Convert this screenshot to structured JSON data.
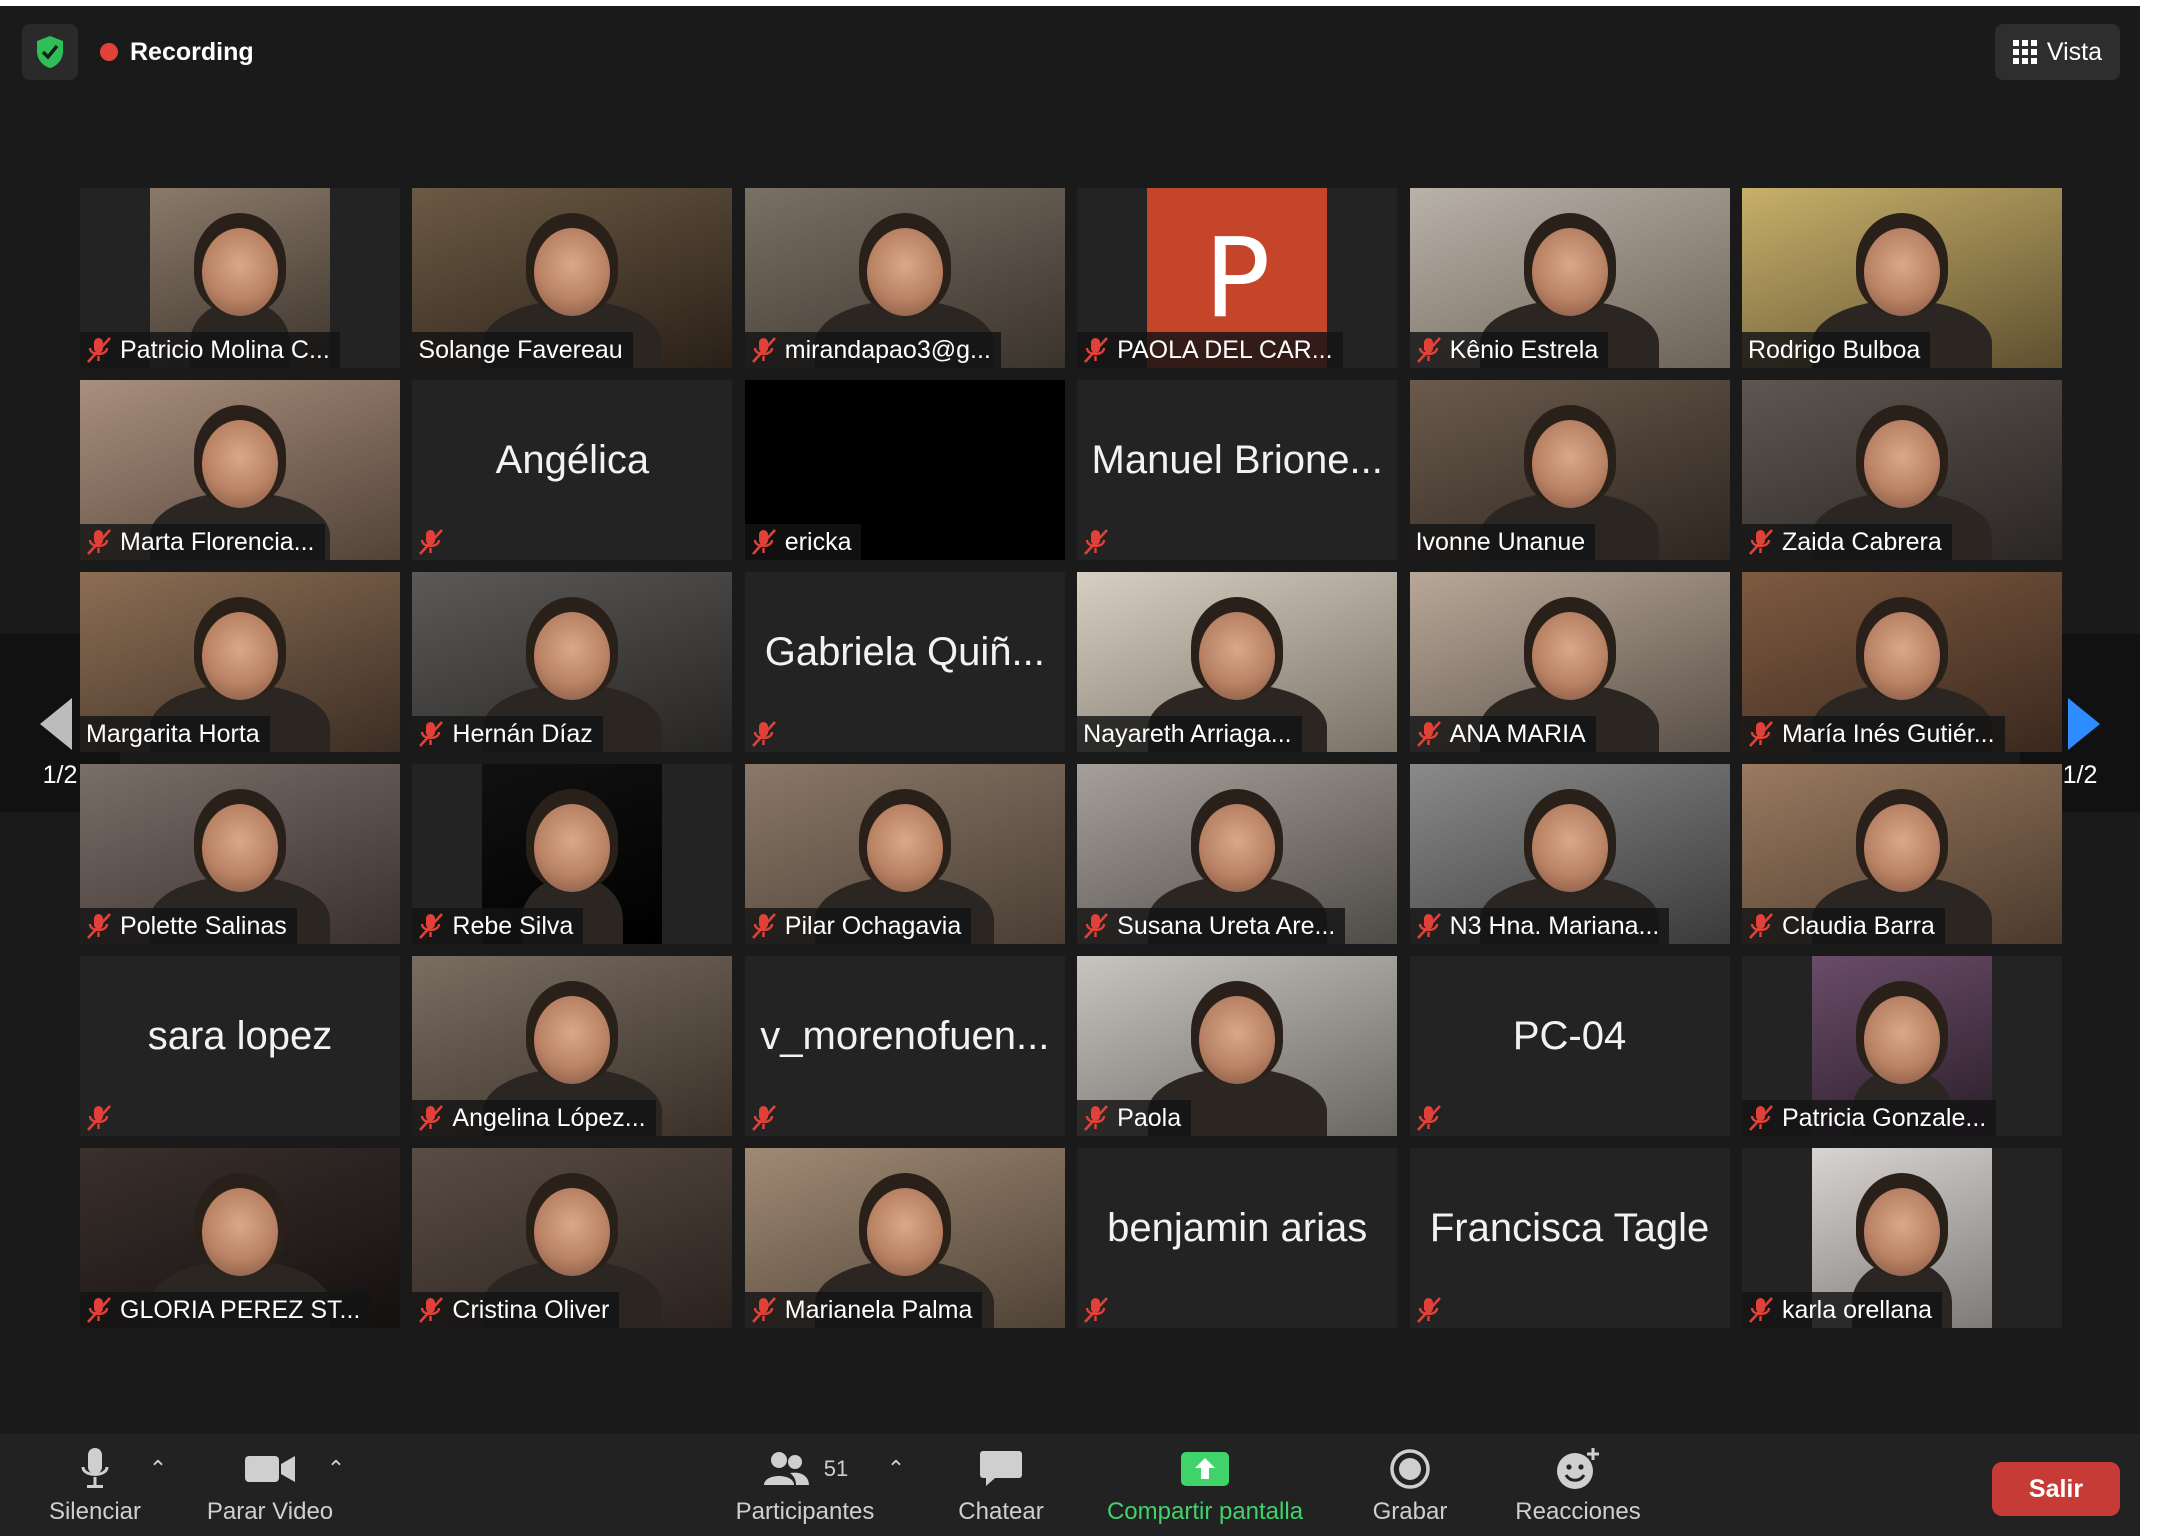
{
  "top_bar": {
    "recording_label": "Recording",
    "view_label": "Vista"
  },
  "pager": {
    "left_page": "1/2",
    "right_page": "1/2"
  },
  "tiles": [
    {
      "name": "Patricio Molina C...",
      "video": true,
      "muted": true
    },
    {
      "name": "Solange Favereau",
      "video": true,
      "muted": false,
      "active": true
    },
    {
      "name": "mirandapao3@g...",
      "video": true,
      "muted": true
    },
    {
      "name": "PAOLA DEL CAR...",
      "video": true,
      "muted": true,
      "icon_letter": "P"
    },
    {
      "name": "Kênio Estrela",
      "video": true,
      "muted": true
    },
    {
      "name": "Rodrigo Bulboa",
      "video": true,
      "muted": false
    },
    {
      "name": "Marta Florencia...",
      "video": true,
      "muted": true
    },
    {
      "name": "Angélica",
      "video": false,
      "muted": true
    },
    {
      "name": "ericka",
      "video": true,
      "muted": true,
      "black": true
    },
    {
      "name": "Manuel Brione...",
      "video": false,
      "muted": true
    },
    {
      "name": "Ivonne Unanue",
      "video": true,
      "muted": false
    },
    {
      "name": "Zaida Cabrera",
      "video": true,
      "muted": true
    },
    {
      "name": "Margarita Horta",
      "video": true,
      "muted": false
    },
    {
      "name": "Hernán Díaz",
      "video": true,
      "muted": true
    },
    {
      "name": "Gabriela Quiñ...",
      "video": false,
      "muted": true
    },
    {
      "name": "Nayareth Arriaga...",
      "video": true,
      "muted": false
    },
    {
      "name": "ANA MARIA",
      "video": true,
      "muted": true
    },
    {
      "name": "María Inés Gutiér...",
      "video": true,
      "muted": true
    },
    {
      "name": "Polette Salinas",
      "video": true,
      "muted": true
    },
    {
      "name": "Rebe Silva",
      "video": true,
      "muted": true
    },
    {
      "name": "Pilar Ochagavia",
      "video": true,
      "muted": true
    },
    {
      "name": "Susana Ureta Are...",
      "video": true,
      "muted": true
    },
    {
      "name": "N3 Hna. Mariana...",
      "video": true,
      "muted": true
    },
    {
      "name": "Claudia Barra",
      "video": true,
      "muted": true
    },
    {
      "name": "sara lopez",
      "video": false,
      "muted": true
    },
    {
      "name": "Angelina López...",
      "video": true,
      "muted": true
    },
    {
      "name": "v_morenofuen...",
      "video": false,
      "muted": true
    },
    {
      "name": "Paola",
      "video": true,
      "muted": true
    },
    {
      "name": "PC-04",
      "video": false,
      "muted": true
    },
    {
      "name": "Patricia Gonzale...",
      "video": true,
      "muted": true
    },
    {
      "name": "GLORIA PEREZ ST...",
      "video": true,
      "muted": true
    },
    {
      "name": "Cristina Oliver",
      "video": true,
      "muted": true
    },
    {
      "name": "Marianela Palma",
      "video": true,
      "muted": true
    },
    {
      "name": "benjamin arias",
      "video": false,
      "muted": true
    },
    {
      "name": "Francisca Tagle",
      "video": false,
      "muted": true
    },
    {
      "name": "karla orellana",
      "video": true,
      "muted": true
    }
  ],
  "toolbar": {
    "mute_label": "Silenciar",
    "video_label": "Parar Video",
    "participants_label": "Participantes",
    "participants_count": "51",
    "chat_label": "Chatear",
    "share_label": "Compartir pantalla",
    "record_label": "Grabar",
    "reactions_label": "Reacciones",
    "exit_label": "Salir"
  },
  "colors": {
    "active_speaker_border": "#d7e25e",
    "share_green": "#40d36b",
    "exit_red": "#c63b35",
    "recording_red": "#e0423a",
    "pager_arrow_blue": "#2d8cff"
  }
}
